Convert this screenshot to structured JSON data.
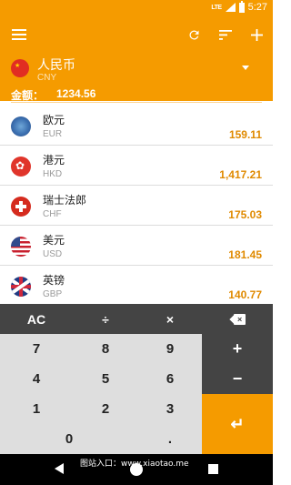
{
  "status_bar": {
    "network": "LTE",
    "time": "5:27"
  },
  "header": {
    "base_currency": {
      "name": "人民币",
      "code": "CNY"
    },
    "amount_label": "金额：",
    "amount_value": "1234.56",
    "icons": [
      "menu-icon",
      "refresh-icon",
      "sort-icon",
      "add-icon"
    ]
  },
  "currencies": [
    {
      "name": "欧元",
      "code": "EUR",
      "value": "159.11",
      "flag": "eu-flag-icon"
    },
    {
      "name": "港元",
      "code": "HKD",
      "value": "1,417.21",
      "flag": "hk-flag-icon"
    },
    {
      "name": "瑞士法郎",
      "code": "CHF",
      "value": "175.03",
      "flag": "ch-flag-icon"
    },
    {
      "name": "美元",
      "code": "USD",
      "value": "181.45",
      "flag": "us-flag-icon"
    },
    {
      "name": "英镑",
      "code": "GBP",
      "value": "140.77",
      "flag": "gb-flag-icon"
    }
  ],
  "keypad": {
    "clear": "AC",
    "divide": "÷",
    "multiply": "×",
    "plus": "+",
    "minus": "−",
    "enter": "↵",
    "dot": ".",
    "digits": [
      "7",
      "8",
      "9",
      "4",
      "5",
      "6",
      "1",
      "2",
      "3",
      "0"
    ]
  },
  "watermark": "图站入口：www.xiaotao.me",
  "colors": {
    "accent": "#f59b00",
    "value_text": "#e08a00",
    "keypad_dark": "#444444",
    "keypad_light": "#dedede"
  }
}
